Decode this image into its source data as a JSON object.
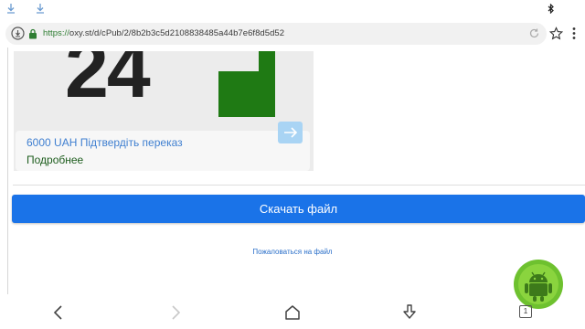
{
  "status_bar": {
    "download_icons": [
      "download-icon",
      "download-icon"
    ],
    "bluetooth_icon": "bluetooth-icon"
  },
  "address_bar": {
    "url_scheme": "https://",
    "url_rest": "oxy.st/d/cPub/2/8b2b3c5d2108838485a44b7e6f8d5d52",
    "icons": [
      "info-icon",
      "lock-icon",
      "reload-icon",
      "star-icon",
      "menu-icon"
    ]
  },
  "ad": {
    "big_text": "24",
    "headline": "6000 UAH Підтвердіть переказ",
    "more_label": "Подробнее",
    "colors": {
      "logo_green": "#1f7a14",
      "arrow_button": "#a9d4f4"
    }
  },
  "main": {
    "download_label": "Скачать файл",
    "report_label": "Пожаловаться на файл",
    "accent": "#1a73e8"
  },
  "bottom_nav": {
    "tab_count": "1",
    "icons": [
      "back-icon",
      "forward-icon",
      "home-icon",
      "downloads-icon",
      "tabs-icon"
    ]
  },
  "overlay": {
    "badge": "android-robot-icon",
    "badge_color": "#6ec12f"
  }
}
